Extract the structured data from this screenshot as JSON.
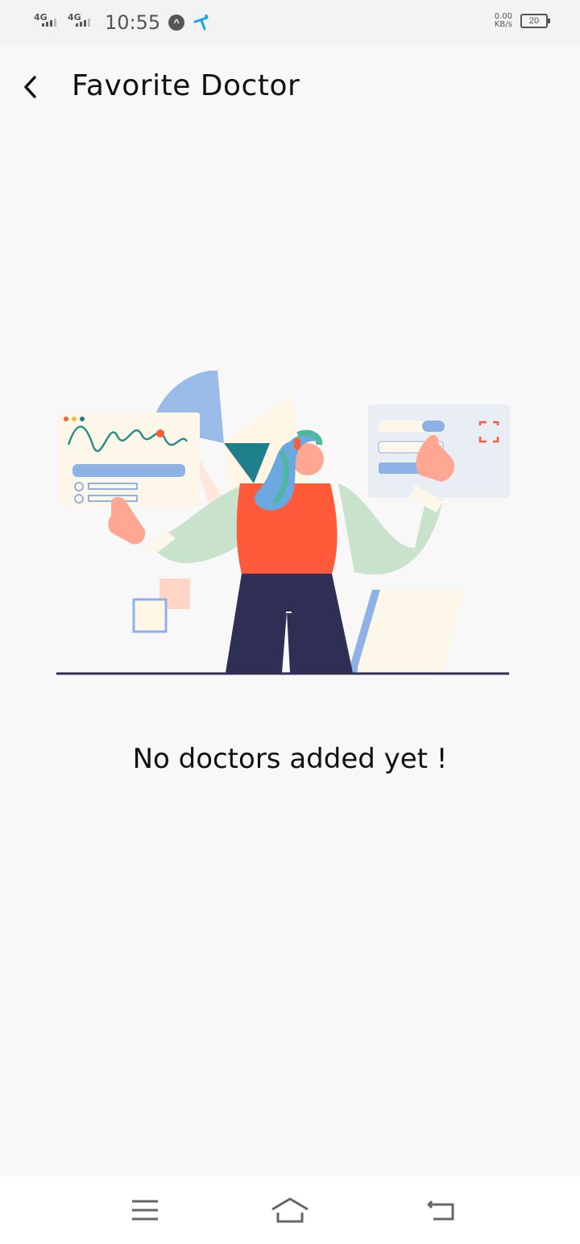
{
  "status_bar": {
    "network_1": "4G",
    "network_2": "4G",
    "time": "10:55",
    "speed_value": "0.00",
    "speed_unit": "KB/s",
    "battery": "20"
  },
  "header": {
    "title": "Favorite Doctor"
  },
  "main": {
    "empty_message": "No doctors added yet !"
  },
  "icons": {
    "back": "back-arrow-icon",
    "menu": "menu-icon",
    "home": "home-icon",
    "return": "return-icon"
  },
  "colors": {
    "background": "#f8f8f8",
    "accent_orange": "#ff5a3a",
    "accent_blue": "#8fb2e6",
    "dark_navy": "#2f2f55",
    "hair_teal": "#4fb6a0",
    "shirt_green": "#c8e2cc"
  }
}
